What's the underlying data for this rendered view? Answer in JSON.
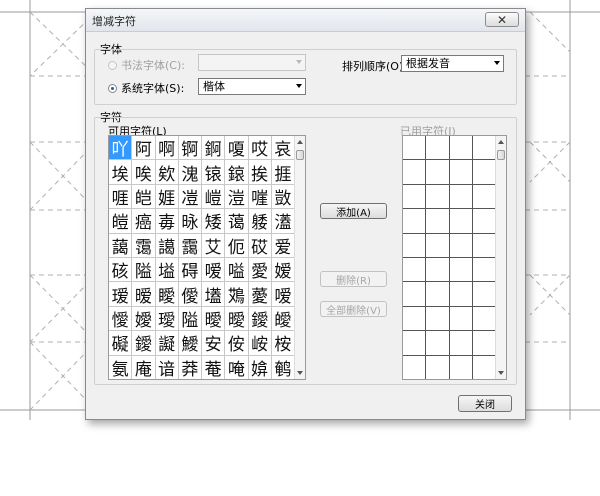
{
  "dialog": {
    "title": "增减字符",
    "close_glyph": "✕",
    "font_group_label": "字体",
    "calligraphy_font_label": "书法字体(C):",
    "calligraphy_font_value": "",
    "system_font_label": "系统字体(S):",
    "system_font_value": "楷体",
    "sort_label": "排列顺序(O):",
    "sort_value": "根据发音",
    "chars_group_label": "字符",
    "available_label": "可用字符(L)",
    "used_label": "已用字符(I)",
    "add_button": "添加(A)",
    "delete_button": "删除(R)",
    "delete_all_button": "全部删除(V)",
    "close_button": "关闭"
  },
  "available_chars": [
    "吖",
    "阿",
    "啊",
    "锕",
    "錒",
    "嗄",
    "哎",
    "哀",
    "埃",
    "唉",
    "欸",
    "溾",
    "锿",
    "鎄",
    "挨",
    "捱",
    "啀",
    "皑",
    "娾",
    "凒",
    "嵦",
    "溰",
    "嘊",
    "敳",
    "皚",
    "癌",
    "毐",
    "昹",
    "矮",
    "蔼",
    "躷",
    "濭",
    "藹",
    "霭",
    "譪",
    "靄",
    "艾",
    "伌",
    "砹",
    "爱",
    "硋",
    "隘",
    "塧",
    "碍",
    "嗳",
    "嗌",
    "愛",
    "嫒",
    "瑷",
    "暧",
    "瞹",
    "僾",
    "壒",
    "鴱",
    "薆",
    "嗳",
    "懓",
    "嬡",
    "璦",
    "隘",
    "曖",
    "曖",
    "鑀",
    "皧",
    "礙",
    "鑀",
    "譺",
    "鱫",
    "安",
    "侒",
    "峖",
    "桉",
    "氨",
    "庵",
    "谙",
    "莽",
    "菴",
    "唵",
    "媕",
    "鹌"
  ],
  "selected_index": 0,
  "used_chars_rows": 10
}
